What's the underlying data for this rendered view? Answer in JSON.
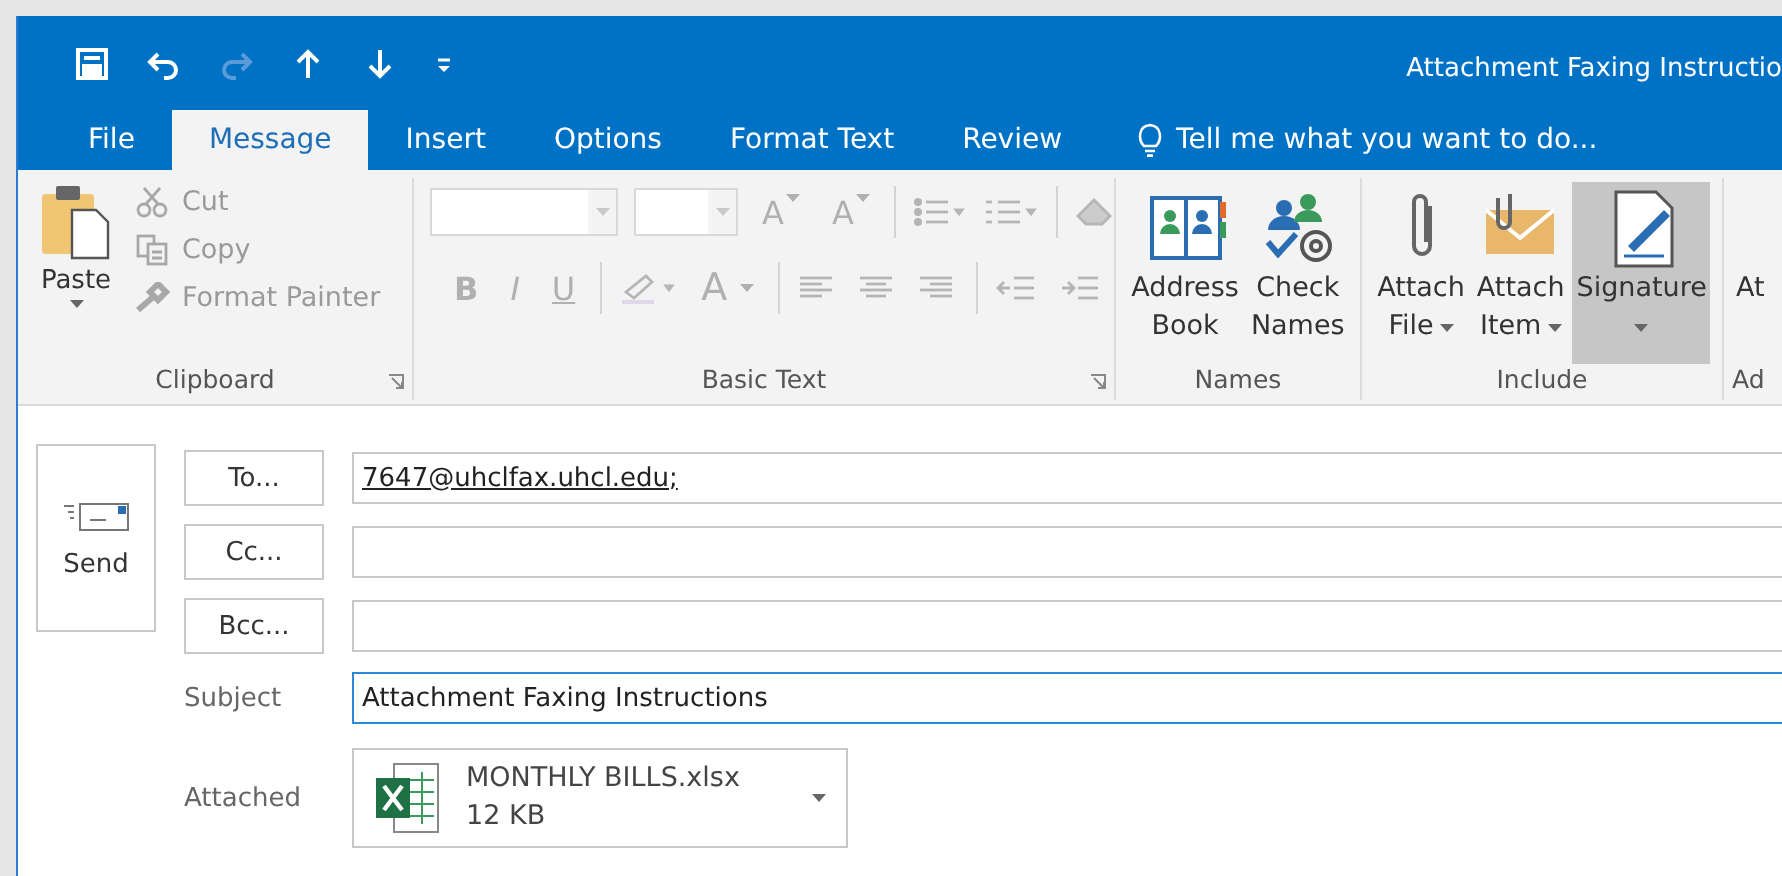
{
  "quick_access": [
    {
      "kind": "save",
      "disabled": false
    },
    {
      "kind": "undo",
      "disabled": false
    },
    {
      "kind": "redo",
      "disabled": true
    },
    {
      "kind": "up",
      "disabled": false
    },
    {
      "kind": "down",
      "disabled": false
    },
    {
      "kind": "customize",
      "disabled": false
    }
  ],
  "window": {
    "title": "Attachment Faxing Instructio"
  },
  "tabs": [
    {
      "label": "File",
      "selected": false
    },
    {
      "label": "Message",
      "selected": true
    },
    {
      "label": "Insert",
      "selected": false
    },
    {
      "label": "Options",
      "selected": false
    },
    {
      "label": "Format Text",
      "selected": false
    },
    {
      "label": "Review",
      "selected": false
    }
  ],
  "tell_me": "Tell me what you want to do...",
  "ribbon": {
    "groups": [
      {
        "kind": "clipboard",
        "label": "Clipboard",
        "launcher": true,
        "paste": {
          "label": "Paste"
        },
        "items": [
          {
            "kind": "cut",
            "label": "Cut",
            "disabled": true
          },
          {
            "kind": "copy",
            "label": "Copy",
            "disabled": true
          },
          {
            "kind": "painter",
            "label": "Format Painter",
            "disabled": true
          }
        ]
      },
      {
        "kind": "basic_text",
        "label": "Basic Text",
        "launcher": true,
        "disabled": true,
        "row1": [
          {
            "kind": "font_box"
          },
          {
            "kind": "size_box"
          },
          {
            "kind": "grow",
            "glyph": "A"
          },
          {
            "kind": "shrink",
            "glyph": "A"
          },
          {
            "kind": "sep"
          },
          {
            "kind": "bullets"
          },
          {
            "kind": "numbering"
          },
          {
            "kind": "sep"
          },
          {
            "kind": "clear"
          }
        ],
        "row2": [
          {
            "kind": "bold",
            "glyph": "B"
          },
          {
            "kind": "italic",
            "glyph": "I"
          },
          {
            "kind": "underline",
            "glyph": "U"
          },
          {
            "kind": "sep"
          },
          {
            "kind": "highlight"
          },
          {
            "kind": "font_color",
            "glyph": "A"
          },
          {
            "kind": "sep"
          },
          {
            "kind": "align_left"
          },
          {
            "kind": "align_center"
          },
          {
            "kind": "align_right"
          },
          {
            "kind": "sep"
          },
          {
            "kind": "outdent"
          },
          {
            "kind": "indent"
          }
        ]
      },
      {
        "kind": "large",
        "label": "Names",
        "launcher": false,
        "buttons": [
          {
            "kind": "address_book",
            "lines": [
              "Address",
              "Book"
            ],
            "dropdown": false,
            "highlighted": false
          },
          {
            "kind": "check_names",
            "lines": [
              "Check",
              "Names"
            ],
            "dropdown": false,
            "highlighted": false
          }
        ]
      },
      {
        "kind": "large",
        "label": "Include",
        "launcher": false,
        "buttons": [
          {
            "kind": "attach_file",
            "lines": [
              "Attach",
              "File"
            ],
            "dropdown": true,
            "highlighted": false
          },
          {
            "kind": "attach_item",
            "lines": [
              "Attach",
              "Item"
            ],
            "dropdown": true,
            "highlighted": false
          },
          {
            "kind": "signature",
            "lines": [
              "Signature"
            ],
            "dropdown": true,
            "highlighted": true
          }
        ]
      },
      {
        "kind": "large",
        "label": "Ad",
        "launcher": false,
        "buttons": [
          {
            "kind": "cut_off",
            "lines": [
              "At"
            ],
            "dropdown": false,
            "highlighted": false
          }
        ]
      }
    ]
  },
  "compose": {
    "send": {
      "label": "Send"
    },
    "recipients": [
      {
        "button": "To...",
        "value": "7647@uhclfax.uhcl.edu;"
      },
      {
        "button": "Cc..."
      },
      {
        "button": "Bcc..."
      }
    ],
    "subject": {
      "label": "Subject",
      "value": "Attachment Faxing Instructions",
      "focused": true
    },
    "attachments": {
      "label": "Attached",
      "files": [
        {
          "name": "MONTHLY BILLS.xlsx",
          "size": "12 KB"
        }
      ]
    }
  }
}
